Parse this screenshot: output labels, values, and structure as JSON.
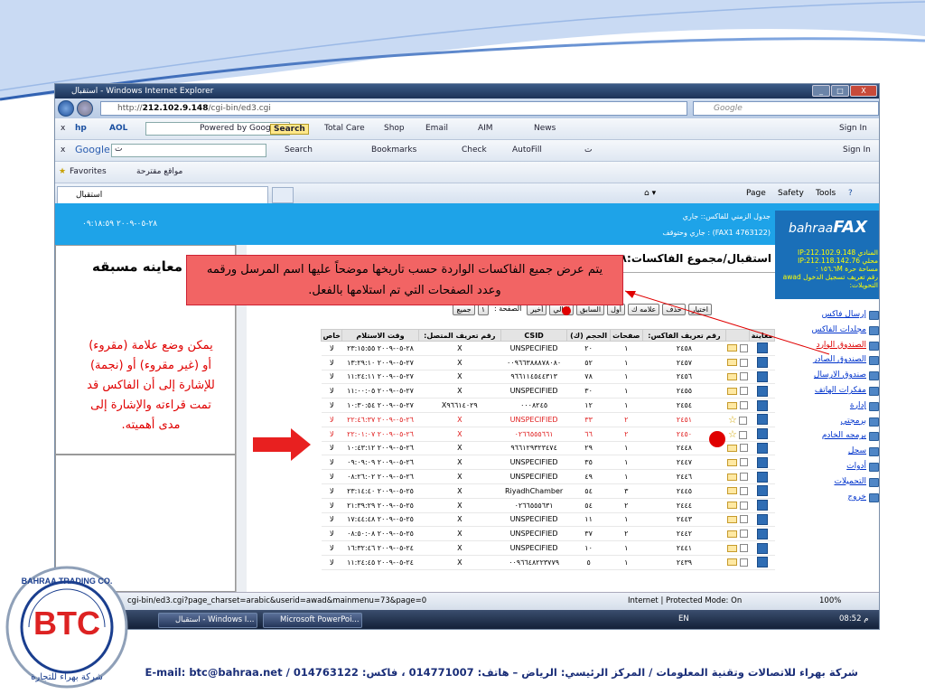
{
  "window": {
    "title": "استقبال - Windows Internet Explorer"
  },
  "address": {
    "url_prefix": "http://",
    "url_host": "212.102.9.148",
    "url_path": "/cgi-bin/ed3.cgi",
    "search_placeholder": "Google"
  },
  "toolbar1": {
    "close": "x",
    "aol": "AOL",
    "powered": "Powered by Google",
    "search": "Search",
    "items": [
      "Total Care",
      "Shop",
      "Email",
      "AIM",
      "News"
    ],
    "signin": "Sign In"
  },
  "toolbar2": {
    "google": "Google",
    "query": "ت",
    "search": "Search",
    "bookmarks": "Bookmarks",
    "check": "Check",
    "autofill": "AutoFill",
    "extra": "ت",
    "signin": "Sign In"
  },
  "favorites": {
    "label": "Favorites",
    "suggested": "مواقع مقترحة"
  },
  "tab": {
    "label": "استقبال"
  },
  "cmdbar": {
    "page": "Page",
    "safety": "Safety",
    "tools": "Tools"
  },
  "band": {
    "datetime": "٢٨-٠٥-٢٠٠٩ ٠٩:١٨:٥٩",
    "line1": "جدول الزمني للفاكس:: جاري",
    "line2": "(4763122 FAX1) : جاري وحتوقف",
    "logo1": "bahraa",
    "logo2": "FAX"
  },
  "info": [
    "المنادي IP:212.102.9.148",
    "محلي IP:212.118.142.76",
    "مساحة حرة ١٥٦.٦M :",
    "رقم تعريف تسجيل الدخول awad",
    "التحويلات:"
  ],
  "menu": [
    "إرسال فاكس",
    "مجلدات الفاكس",
    "الصندوق الوارد",
    "الصندوق الصادر",
    "صندوق الارسال",
    "مفكرات الهاتف",
    "إدارة",
    "برمجتي",
    "برمجه الخادم",
    "سجل",
    "أدوات",
    "التحميلات",
    "خروج"
  ],
  "main": {
    "title": "استقبال/مجموع الفاكسات:٧٠٨",
    "page_label": "الصفحة :",
    "page_value": "١",
    "all": "جميع",
    "mark": "علامه ك",
    "buttons": [
      "اختيار",
      "حذف",
      "أول",
      "السابق",
      "التالي",
      "أخير"
    ]
  },
  "table": {
    "headers": [
      "معاينة",
      "",
      "رقم تعريف الفاكس:",
      "صفحات",
      "الحجم (ك)",
      "CSID",
      "رقم تعريف المتصل:",
      "وقت الاستلام",
      "خاص"
    ],
    "rows": [
      {
        "id": "٢٤٥٨",
        "pages": "١",
        "size": "٢٠",
        "csid": "UNSPECIFIED",
        "caller": "X",
        "time": "٢٨-٠٥-٢٠٠٩ ٢٣:١٥:٥٥",
        "priv": "لا",
        "state": "read"
      },
      {
        "id": "٢٤٥٧",
        "pages": "١",
        "size": "٥٢",
        "csid": "٠٠٩٦٦٣٨٨٨٧٨٠٨٠",
        "caller": "X",
        "time": "٢٧-٠٥-٢٠٠٩ ١٣:٢٩:١٠",
        "priv": "لا",
        "state": "read"
      },
      {
        "id": "٢٤٥٦",
        "pages": "١",
        "size": "٧٨",
        "csid": "٩٦٦١١٤٥٤٤٣١٣",
        "caller": "X",
        "time": "٢٧-٠٥-٢٠٠٩ ١١:٢٤:١١",
        "priv": "لا",
        "state": "opened"
      },
      {
        "id": "٢٤٥٥",
        "pages": "١",
        "size": "٣٠",
        "csid": "UNSPECIFIED",
        "caller": "X",
        "time": "٢٧-٠٥-٢٠٠٩ ١١:٠٠:٠٥",
        "priv": "لا",
        "state": "read"
      },
      {
        "id": "٢٤٥٤",
        "pages": "١",
        "size": "١٢",
        "csid": "٠٠٠٨٢٤٥",
        "caller": "X٩٦٦١٤٠٢٩",
        "time": "٢٧-٠٥-٢٠٠٩ ١٠:٣٠:٥٤",
        "priv": "لا",
        "state": "read"
      },
      {
        "id": "٢٤٥١",
        "pages": "٢",
        "size": "٣٣",
        "csid": "UNSPECIFIED",
        "caller": "X",
        "time": "٢٦-٠٥-٢٠٠٩ ٢٢:٤٦:٣٧",
        "priv": "لا",
        "state": "unread"
      },
      {
        "id": "٢٤٥٠",
        "pages": "٢",
        "size": "٦٦",
        "csid": "٠٢٦٦٥٥٥٦٦١",
        "caller": "X",
        "time": "٢٦-٠٥-٢٠٠٩ ٢٢:٠١:٠٧",
        "priv": "لا",
        "state": "unread"
      },
      {
        "id": "٢٤٤٨",
        "pages": "١",
        "size": "٢٩",
        "csid": "٩٦٦١٢٩٣٢٣٤٧٤",
        "caller": "X",
        "time": "٢٦-٠٥-٢٠٠٩ ١٠:٤٣:١٢",
        "priv": "لا",
        "state": "opened"
      },
      {
        "id": "٢٤٤٧",
        "pages": "١",
        "size": "٣٥",
        "csid": "UNSPECIFIED",
        "caller": "X",
        "time": "٢٦-٠٥-٢٠٠٩ ٠٩:٠٩:٠٩",
        "priv": "لا",
        "state": "read"
      },
      {
        "id": "٢٤٤٦",
        "pages": "١",
        "size": "٤٩",
        "csid": "UNSPECIFIED",
        "caller": "X",
        "time": "٢٦-٠٥-٢٠٠٩ ٠٨:٢٦:٠٢",
        "priv": "لا",
        "state": "read"
      },
      {
        "id": "٢٤٤٥",
        "pages": "٣",
        "size": "٥٤",
        "csid": "RiyadhChamber",
        "caller": "X",
        "time": "٢٥-٠٥-٢٠٠٩ ٢٣:١٤:٤٠",
        "priv": "لا",
        "state": "read"
      },
      {
        "id": "٢٤٤٤",
        "pages": "٢",
        "size": "٥٤",
        "csid": "٠٢٦٦٥٥٥٦٣١",
        "caller": "X",
        "time": "٢٥-٠٥-٢٠٠٩ ٢١:٣٩:٢٩",
        "priv": "لا",
        "state": "read"
      },
      {
        "id": "٢٤٤٣",
        "pages": "١",
        "size": "١١",
        "csid": "UNSPECIFIED",
        "caller": "X",
        "time": "٢٥-٠٥-٢٠٠٩ ١٧:٤٤:٤٨",
        "priv": "لا",
        "state": "read"
      },
      {
        "id": "٢٤٤٢",
        "pages": "٢",
        "size": "٣٧",
        "csid": "UNSPECIFIED",
        "caller": "X",
        "time": "٢٥-٠٥-٢٠٠٩ ٠٨:٥٠:٠٨",
        "priv": "لا",
        "state": "opened"
      },
      {
        "id": "٢٤٤١",
        "pages": "١",
        "size": "١٠",
        "csid": "UNSPECIFIED",
        "caller": "X",
        "time": "٢٤-٠٥-٢٠٠٩ ١٦:٣٢:٤٦",
        "priv": "لا",
        "state": "opened"
      },
      {
        "id": "٢٤٣٩",
        "pages": "١",
        "size": "٥",
        "csid": "٠٠٩٦٦٤٨٢٢٣٧٧٩",
        "caller": "X",
        "time": "٢٤-٠٥-٢٠٠٩ ١١:٢٤:٤٥",
        "priv": "لا",
        "state": "read"
      }
    ]
  },
  "status": {
    "url": "cgi-bin/ed3.cgi?page_charset=arabic&userid=awad&mainmenu=73&page=0",
    "zone": "Internet | Protected Mode: On",
    "zoom": "100%"
  },
  "taskbar": {
    "ie": "استقبال - Windows I...",
    "ppt": "Microsoft PowerPoi...",
    "lang": "EN",
    "clock": "08:52 م"
  },
  "slide": {
    "callout": "يتم عرض جميع الفاكسات الواردة حسب تاريخها موضحاً عليها اسم المرسل ورقمه وعدد الصفحات التي تم استلامها بالفعل.",
    "preview": "معاينه مسبقه",
    "note": "يمكن وضع علامة (مقروء) أو (غير مقروء) أو (نجمة) للإشارة إلى أن الفاكس قد تمت قراءته والإشارة إلى مدى أهميته.",
    "footer": "شركة بهراء للاتصالات وتقنية المعلومات / المركز الرئيسي: الرياض – هاتف: 014771007 ، فاكس: 014763122 / E-mail: btc@bahraa.net",
    "logo_top": "BAHRAA TRADING CO.",
    "logo_mid": "BTC",
    "logo_bottom": "شركة بهراء للتجارة"
  },
  "colors": {
    "band": "#1ea3e8",
    "callout": "#f26464",
    "note": "#e00000",
    "footer": "#1a2e78",
    "unread": "#e02020"
  }
}
